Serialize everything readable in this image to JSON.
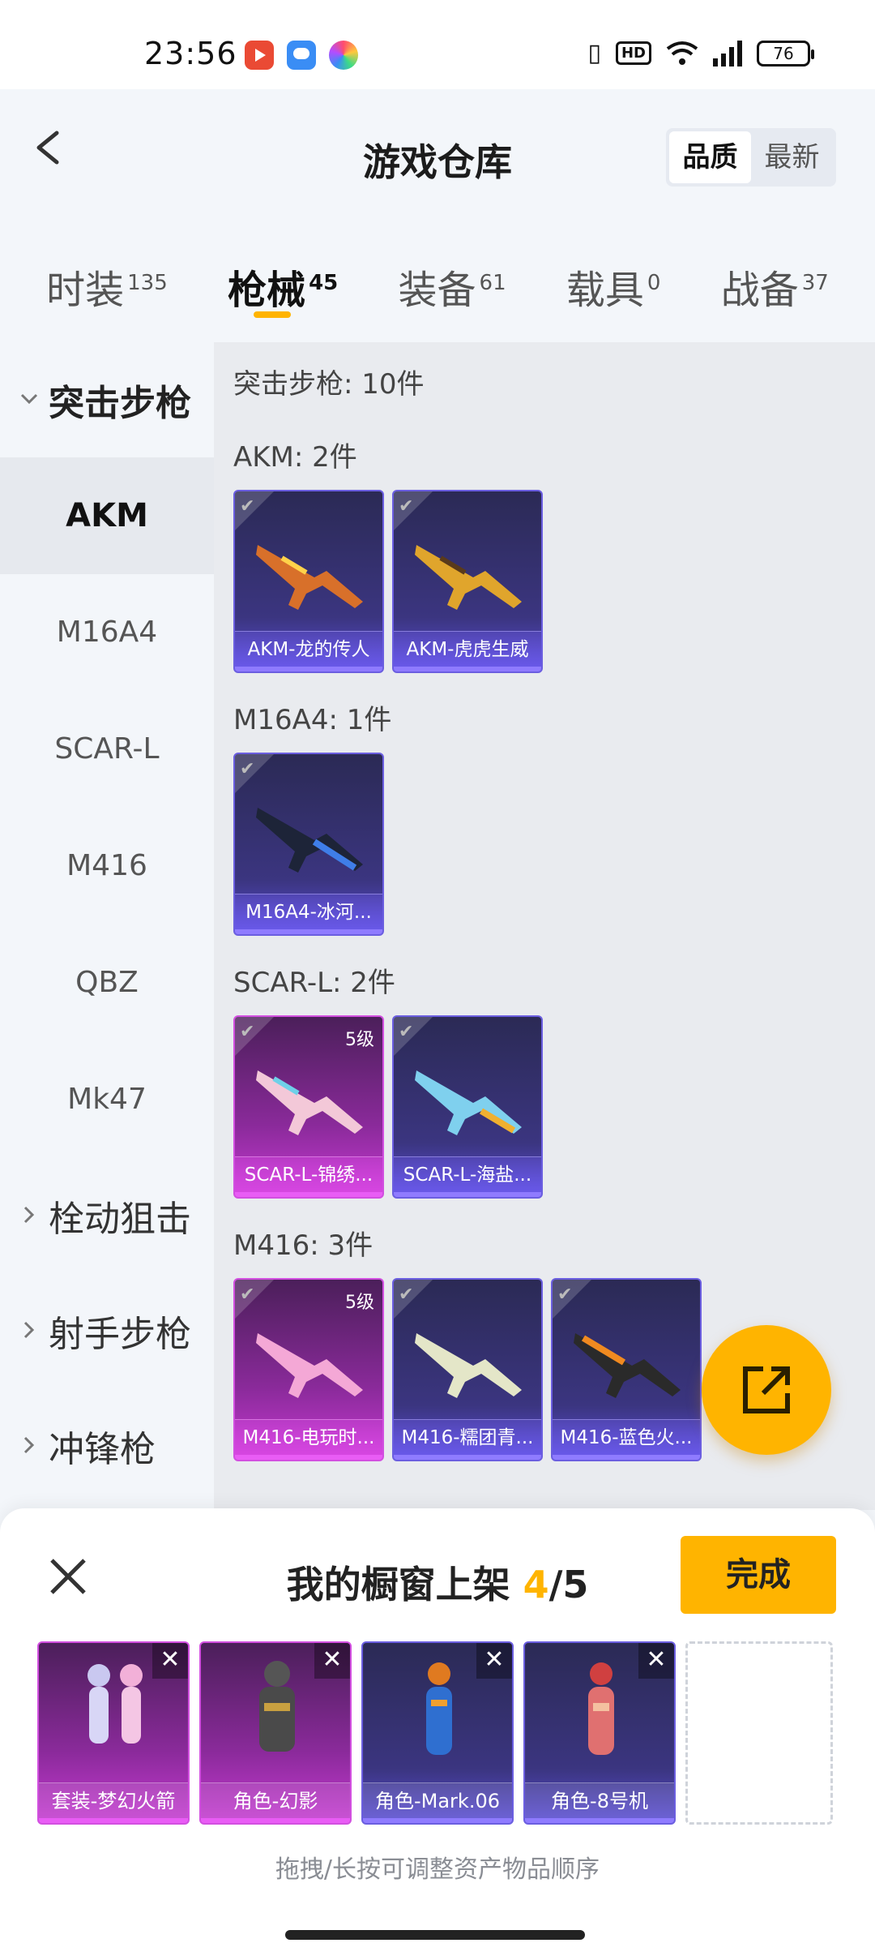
{
  "status_bar": {
    "time": "23:56",
    "battery": "76"
  },
  "header": {
    "title": "游戏仓库",
    "sort_options": [
      "品质",
      "最新"
    ],
    "active_sort": "品质"
  },
  "tabs": [
    {
      "label": "时装",
      "count": "135"
    },
    {
      "label": "枪械",
      "count": "45"
    },
    {
      "label": "装备",
      "count": "61"
    },
    {
      "label": "载具",
      "count": "0"
    },
    {
      "label": "战备",
      "count": "37"
    }
  ],
  "active_tab": "枪械",
  "sidebar": {
    "open_category": "突击步枪",
    "sub_items": [
      "AKM",
      "M16A4",
      "SCAR-L",
      "M416",
      "QBZ",
      "Mk47"
    ],
    "active_sub": "AKM",
    "other_categories": [
      "栓动狙击",
      "射手步枪",
      "冲锋枪"
    ]
  },
  "content": {
    "summary": "突击步枪: 10件",
    "groups": [
      {
        "title": "AKM: 2件",
        "items": [
          {
            "name": "AKM-龙的传人",
            "rarity": "purple",
            "level": ""
          },
          {
            "name": "AKM-虎虎生威",
            "rarity": "purple",
            "level": ""
          }
        ]
      },
      {
        "title": "M16A4: 1件",
        "items": [
          {
            "name": "M16A4-冰河...",
            "rarity": "purple",
            "level": ""
          }
        ]
      },
      {
        "title": "SCAR-L: 2件",
        "items": [
          {
            "name": "SCAR-L-锦绣...",
            "rarity": "pink",
            "level": "5级"
          },
          {
            "name": "SCAR-L-海盐...",
            "rarity": "purple",
            "level": ""
          }
        ]
      },
      {
        "title": "M416: 3件",
        "items": [
          {
            "name": "M416-电玩时...",
            "rarity": "pink",
            "level": "5级"
          },
          {
            "name": "M416-糯团青...",
            "rarity": "purple",
            "level": ""
          },
          {
            "name": "M416-蓝色火...",
            "rarity": "purple",
            "level": ""
          }
        ]
      }
    ]
  },
  "sheet": {
    "title_prefix": "我的橱窗上架",
    "count": "4",
    "total": "/5",
    "done_label": "完成",
    "showcase": [
      {
        "name": "套装-梦幻火箭",
        "rarity": "pink"
      },
      {
        "name": "角色-幻影",
        "rarity": "pink"
      },
      {
        "name": "角色-Mark.06",
        "rarity": "purple"
      },
      {
        "name": "角色-8号机",
        "rarity": "purple"
      }
    ],
    "remove_glyph": "✕",
    "hint": "拖拽/长按可调整资产物品顺序"
  },
  "colors": {
    "accent": "#ffb400",
    "purple_rarity": "#6b5ee0",
    "pink_rarity": "#d24fe0"
  }
}
